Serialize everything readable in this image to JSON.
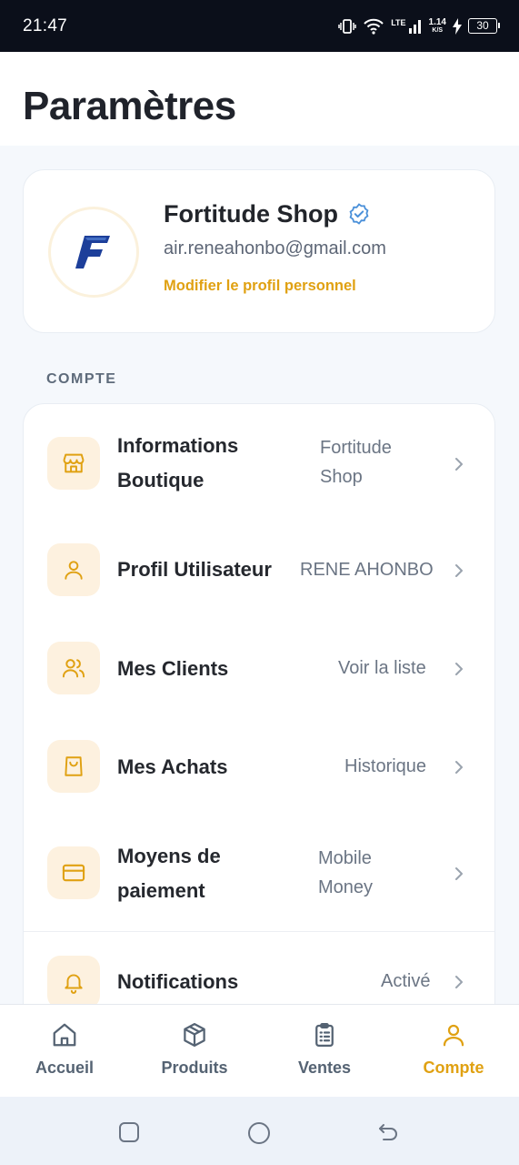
{
  "status_bar": {
    "time": "21:47",
    "network_type": "LTE",
    "speed_value": "1.14",
    "speed_unit": "K/S",
    "battery": "30"
  },
  "header": {
    "title": "Paramètres"
  },
  "profile": {
    "name": "Fortitude Shop",
    "email": "air.reneahonbo@gmail.com",
    "edit_link": "Modifier le profil personnel",
    "logo_letter": "F",
    "verified_icon": "verified-check-icon"
  },
  "section": {
    "label": "COMPTE"
  },
  "settings": [
    {
      "icon": "store-icon",
      "label_line1": "Informations",
      "label_line2": "Boutique",
      "value_line1": "Fortitude",
      "value_line2": "Shop"
    },
    {
      "icon": "user-icon",
      "label_line1": "Profil Utilisateur",
      "value_line1": "RENE AHONBO"
    },
    {
      "icon": "users-icon",
      "label_line1": "Mes Clients",
      "value_line1": "Voir la liste"
    },
    {
      "icon": "shopping-bag-icon",
      "label_line1": "Mes Achats",
      "value_line1": "Historique"
    },
    {
      "icon": "credit-card-icon",
      "label_line1": "Moyens de",
      "label_line2": "paiement",
      "value_line1": "Mobile",
      "value_line2": "Money"
    },
    {
      "icon": "bell-icon",
      "label_line1": "Notifications",
      "value_line1": "Activé"
    }
  ],
  "bottom_nav": {
    "items": [
      {
        "label": "Accueil",
        "icon": "home-icon",
        "active": false
      },
      {
        "label": "Produits",
        "icon": "box-icon",
        "active": false
      },
      {
        "label": "Ventes",
        "icon": "clipboard-list-icon",
        "active": false
      },
      {
        "label": "Compte",
        "icon": "user-icon",
        "active": true
      }
    ]
  },
  "colors": {
    "accent": "#e0a112",
    "icon_bg": "#fdf1df",
    "verified": "#4a90d9",
    "logo_blue": "#1d3f9a"
  }
}
